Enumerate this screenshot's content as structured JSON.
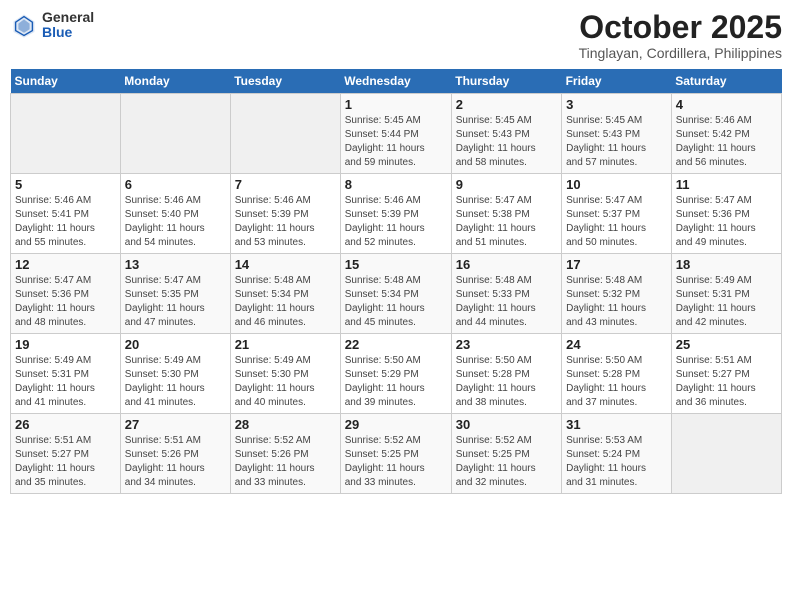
{
  "logo": {
    "general": "General",
    "blue": "Blue"
  },
  "title": "October 2025",
  "subtitle": "Tinglayan, Cordillera, Philippines",
  "headers": [
    "Sunday",
    "Monday",
    "Tuesday",
    "Wednesday",
    "Thursday",
    "Friday",
    "Saturday"
  ],
  "weeks": [
    [
      {
        "day": "",
        "info": ""
      },
      {
        "day": "",
        "info": ""
      },
      {
        "day": "",
        "info": ""
      },
      {
        "day": "1",
        "info": "Sunrise: 5:45 AM\nSunset: 5:44 PM\nDaylight: 11 hours\nand 59 minutes."
      },
      {
        "day": "2",
        "info": "Sunrise: 5:45 AM\nSunset: 5:43 PM\nDaylight: 11 hours\nand 58 minutes."
      },
      {
        "day": "3",
        "info": "Sunrise: 5:45 AM\nSunset: 5:43 PM\nDaylight: 11 hours\nand 57 minutes."
      },
      {
        "day": "4",
        "info": "Sunrise: 5:46 AM\nSunset: 5:42 PM\nDaylight: 11 hours\nand 56 minutes."
      }
    ],
    [
      {
        "day": "5",
        "info": "Sunrise: 5:46 AM\nSunset: 5:41 PM\nDaylight: 11 hours\nand 55 minutes."
      },
      {
        "day": "6",
        "info": "Sunrise: 5:46 AM\nSunset: 5:40 PM\nDaylight: 11 hours\nand 54 minutes."
      },
      {
        "day": "7",
        "info": "Sunrise: 5:46 AM\nSunset: 5:39 PM\nDaylight: 11 hours\nand 53 minutes."
      },
      {
        "day": "8",
        "info": "Sunrise: 5:46 AM\nSunset: 5:39 PM\nDaylight: 11 hours\nand 52 minutes."
      },
      {
        "day": "9",
        "info": "Sunrise: 5:47 AM\nSunset: 5:38 PM\nDaylight: 11 hours\nand 51 minutes."
      },
      {
        "day": "10",
        "info": "Sunrise: 5:47 AM\nSunset: 5:37 PM\nDaylight: 11 hours\nand 50 minutes."
      },
      {
        "day": "11",
        "info": "Sunrise: 5:47 AM\nSunset: 5:36 PM\nDaylight: 11 hours\nand 49 minutes."
      }
    ],
    [
      {
        "day": "12",
        "info": "Sunrise: 5:47 AM\nSunset: 5:36 PM\nDaylight: 11 hours\nand 48 minutes."
      },
      {
        "day": "13",
        "info": "Sunrise: 5:47 AM\nSunset: 5:35 PM\nDaylight: 11 hours\nand 47 minutes."
      },
      {
        "day": "14",
        "info": "Sunrise: 5:48 AM\nSunset: 5:34 PM\nDaylight: 11 hours\nand 46 minutes."
      },
      {
        "day": "15",
        "info": "Sunrise: 5:48 AM\nSunset: 5:34 PM\nDaylight: 11 hours\nand 45 minutes."
      },
      {
        "day": "16",
        "info": "Sunrise: 5:48 AM\nSunset: 5:33 PM\nDaylight: 11 hours\nand 44 minutes."
      },
      {
        "day": "17",
        "info": "Sunrise: 5:48 AM\nSunset: 5:32 PM\nDaylight: 11 hours\nand 43 minutes."
      },
      {
        "day": "18",
        "info": "Sunrise: 5:49 AM\nSunset: 5:31 PM\nDaylight: 11 hours\nand 42 minutes."
      }
    ],
    [
      {
        "day": "19",
        "info": "Sunrise: 5:49 AM\nSunset: 5:31 PM\nDaylight: 11 hours\nand 41 minutes."
      },
      {
        "day": "20",
        "info": "Sunrise: 5:49 AM\nSunset: 5:30 PM\nDaylight: 11 hours\nand 41 minutes."
      },
      {
        "day": "21",
        "info": "Sunrise: 5:49 AM\nSunset: 5:30 PM\nDaylight: 11 hours\nand 40 minutes."
      },
      {
        "day": "22",
        "info": "Sunrise: 5:50 AM\nSunset: 5:29 PM\nDaylight: 11 hours\nand 39 minutes."
      },
      {
        "day": "23",
        "info": "Sunrise: 5:50 AM\nSunset: 5:28 PM\nDaylight: 11 hours\nand 38 minutes."
      },
      {
        "day": "24",
        "info": "Sunrise: 5:50 AM\nSunset: 5:28 PM\nDaylight: 11 hours\nand 37 minutes."
      },
      {
        "day": "25",
        "info": "Sunrise: 5:51 AM\nSunset: 5:27 PM\nDaylight: 11 hours\nand 36 minutes."
      }
    ],
    [
      {
        "day": "26",
        "info": "Sunrise: 5:51 AM\nSunset: 5:27 PM\nDaylight: 11 hours\nand 35 minutes."
      },
      {
        "day": "27",
        "info": "Sunrise: 5:51 AM\nSunset: 5:26 PM\nDaylight: 11 hours\nand 34 minutes."
      },
      {
        "day": "28",
        "info": "Sunrise: 5:52 AM\nSunset: 5:26 PM\nDaylight: 11 hours\nand 33 minutes."
      },
      {
        "day": "29",
        "info": "Sunrise: 5:52 AM\nSunset: 5:25 PM\nDaylight: 11 hours\nand 33 minutes."
      },
      {
        "day": "30",
        "info": "Sunrise: 5:52 AM\nSunset: 5:25 PM\nDaylight: 11 hours\nand 32 minutes."
      },
      {
        "day": "31",
        "info": "Sunrise: 5:53 AM\nSunset: 5:24 PM\nDaylight: 11 hours\nand 31 minutes."
      },
      {
        "day": "",
        "info": ""
      }
    ]
  ]
}
